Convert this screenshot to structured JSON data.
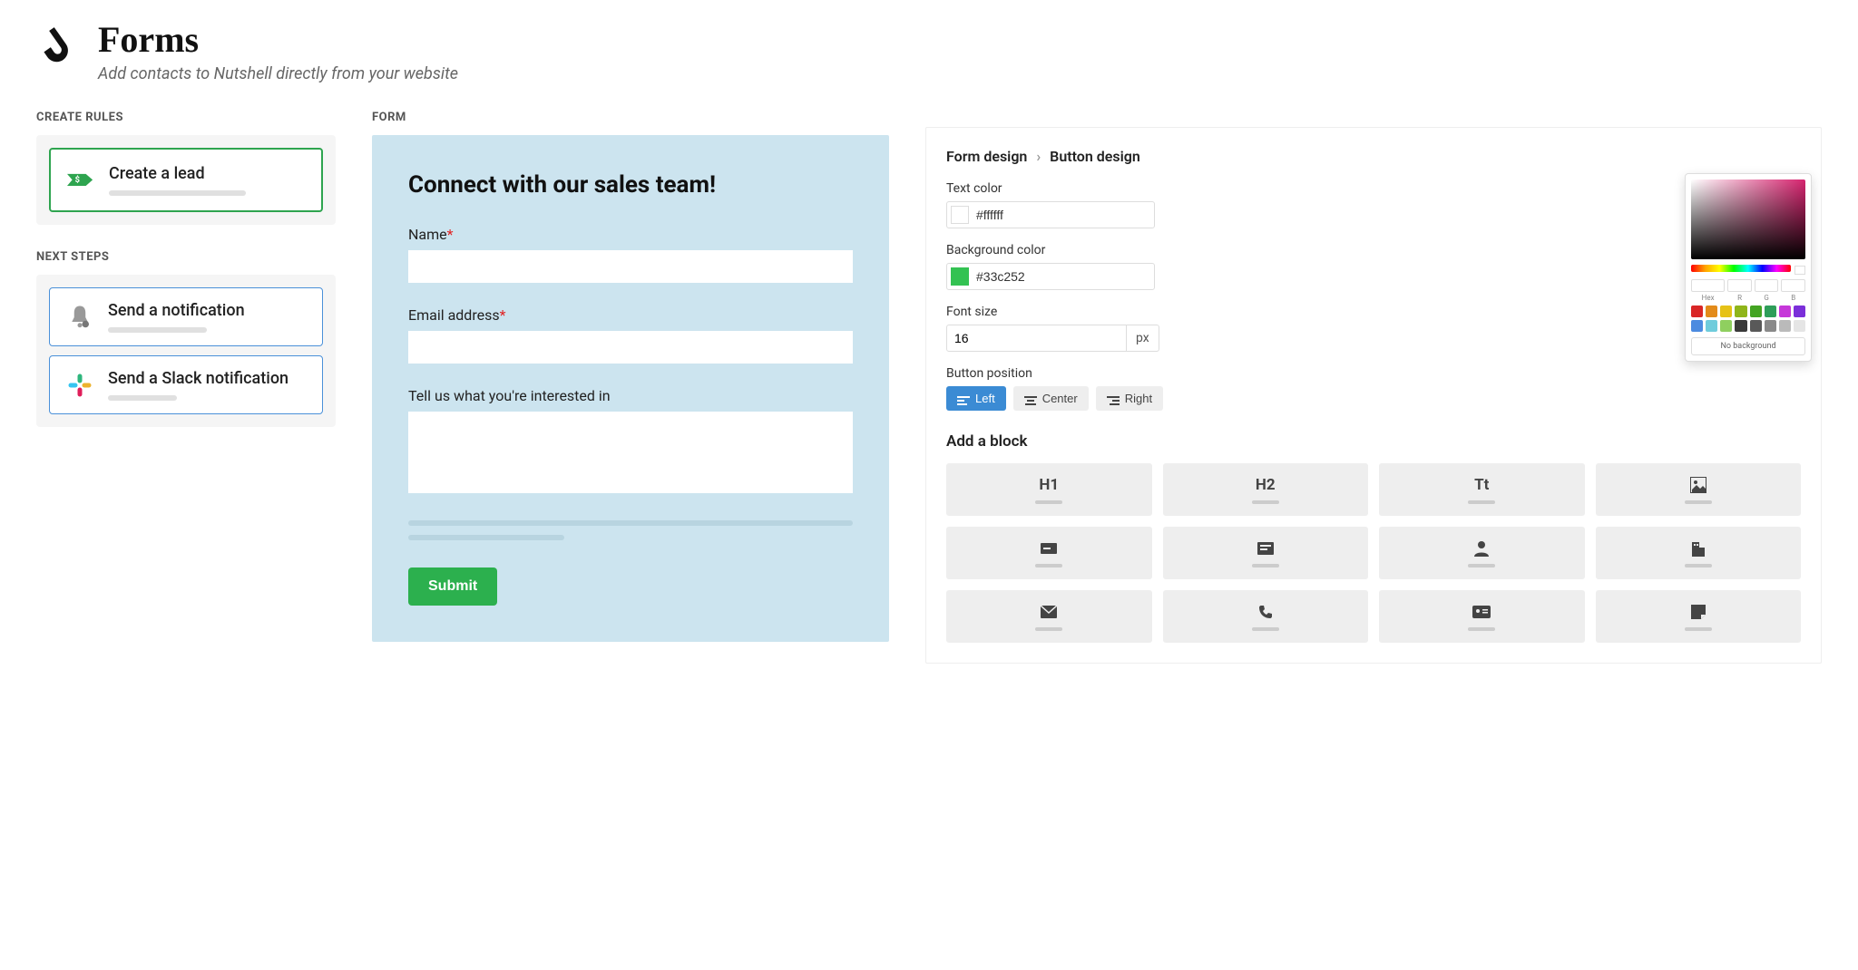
{
  "header": {
    "title": "Forms",
    "subtitle": "Add contacts to Nutshell directly from your website"
  },
  "sidebar": {
    "create_rules_label": "CREATE RULES",
    "next_steps_label": "NEXT STEPS",
    "rule": {
      "title": "Create a lead"
    },
    "steps": [
      {
        "title": "Send a notification",
        "icon": "bell-icon"
      },
      {
        "title": "Send a Slack notification",
        "icon": "slack-icon"
      }
    ]
  },
  "form": {
    "section_label": "FORM",
    "title": "Connect with our sales team!",
    "fields": [
      {
        "label": "Name",
        "required": true,
        "type": "text"
      },
      {
        "label": "Email address",
        "required": true,
        "type": "text"
      },
      {
        "label": "Tell us what you're interested in",
        "required": false,
        "type": "textarea"
      }
    ],
    "submit_label": "Submit"
  },
  "design": {
    "breadcrumb": [
      "Form design",
      "Button design"
    ],
    "text_color_label": "Text color",
    "text_color": "#ffffff",
    "bg_color_label": "Background color",
    "bg_color": "#33c252",
    "font_size_label": "Font size",
    "font_size": "16",
    "font_unit": "px",
    "position_label": "Button position",
    "positions": {
      "left": "Left",
      "center": "Center",
      "right": "Right"
    },
    "position_active": "left",
    "add_block_label": "Add a block",
    "blocks": [
      "H1",
      "H2",
      "Tt",
      "image",
      "single-line",
      "multi-line",
      "person",
      "company",
      "email",
      "phone",
      "id-card",
      "note"
    ]
  },
  "colorpicker": {
    "labels": [
      "Hex",
      "R",
      "G",
      "B"
    ],
    "swatches": [
      "#d92626",
      "#e38b1a",
      "#e6c217",
      "#8fb51a",
      "#43a422",
      "#2e9e59",
      "#c637d9",
      "#7b2fd9",
      "#4c8be0",
      "#6fccdc",
      "#8fcf5f",
      "#3a3a3a",
      "#595959",
      "#8a8a8a",
      "#bababa",
      "#e5e5e5"
    ],
    "no_bg": "No background"
  }
}
